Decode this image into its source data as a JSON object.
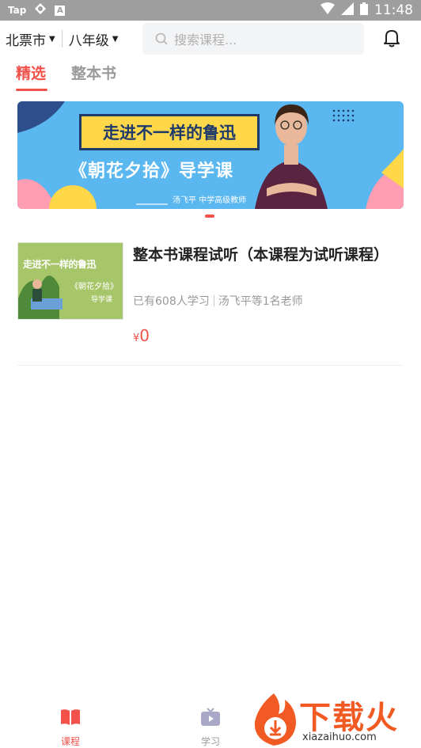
{
  "status_bar": {
    "left_app": "Tap",
    "left_letter": "A",
    "time": "11:48"
  },
  "header": {
    "city": "北票市",
    "grade": "八年级",
    "search_placeholder": "搜索课程..."
  },
  "tabs": [
    {
      "label": "精选",
      "active": true
    },
    {
      "label": "整本书",
      "active": false
    }
  ],
  "banner": {
    "title": "走进不一样的鲁迅",
    "subtitle": "《朝花夕拾》导学课",
    "teacher": "汤飞平  中学高级教师"
  },
  "courses": [
    {
      "thumb_title": "走进不一样的鲁迅",
      "thumb_sub": "《朝花夕拾》",
      "thumb_sub2": "导学课",
      "title": "整本书课程试听（本课程为试听课程）",
      "learners": "已有608人学习",
      "teachers": "汤飞平等1名老师",
      "currency": "¥",
      "price": "0"
    }
  ],
  "bottom_nav": [
    {
      "label": "课程",
      "active": true,
      "icon": "book-icon"
    },
    {
      "label": "学习",
      "active": false,
      "icon": "tv-play-icon"
    }
  ],
  "watermark": {
    "text": "下载火",
    "url": "xiazaihuo.com"
  },
  "colors": {
    "accent": "#f3524b",
    "banner_bg": "#5bb7ef",
    "inactive": "#9a9a9a"
  }
}
